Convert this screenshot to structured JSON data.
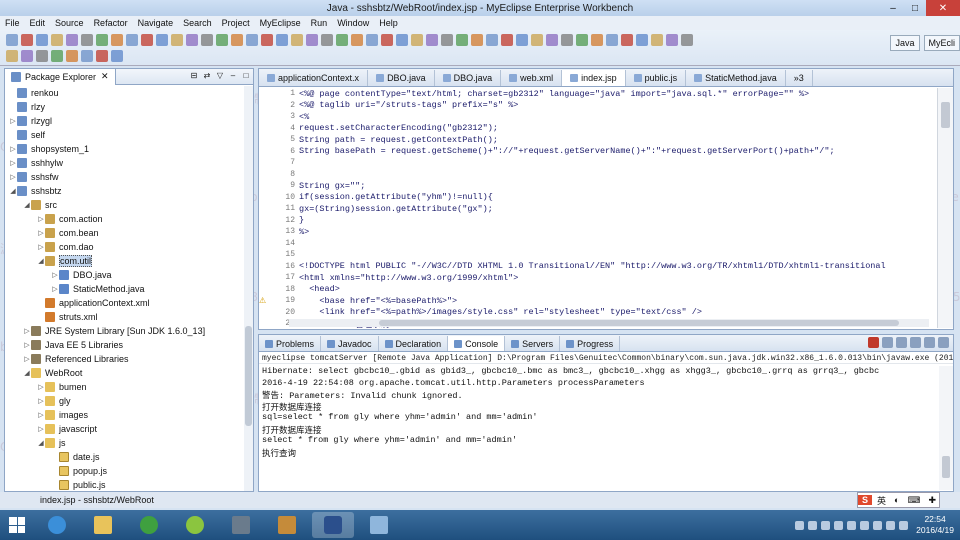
{
  "window": {
    "title": "Java - sshsbtz/WebRoot/index.jsp - MyEclipse Enterprise Workbench",
    "min": "–",
    "max": "□",
    "close": "✕"
  },
  "menu": [
    "File",
    "Edit",
    "Source",
    "Refactor",
    "Navigate",
    "Search",
    "Project",
    "MyEclipse",
    "Run",
    "Window",
    "Help"
  ],
  "perspectives": {
    "java": "Java",
    "myeclipse": "MyEcli"
  },
  "explorer": {
    "title": "Package Explorer",
    "items": [
      {
        "label": "renkou",
        "indent": 0,
        "tw": "",
        "icon": "proj"
      },
      {
        "label": "rlzy",
        "indent": 0,
        "tw": "",
        "icon": "proj"
      },
      {
        "label": "rlzygl",
        "indent": 0,
        "tw": "▷",
        "icon": "proj"
      },
      {
        "label": "self",
        "indent": 0,
        "tw": "",
        "icon": "proj"
      },
      {
        "label": "shopsystem_1",
        "indent": 0,
        "tw": "▷",
        "icon": "proj"
      },
      {
        "label": "sshhylw",
        "indent": 0,
        "tw": "▷",
        "icon": "proj"
      },
      {
        "label": "sshsfw",
        "indent": 0,
        "tw": "▷",
        "icon": "proj"
      },
      {
        "label": "sshsbtz",
        "indent": 0,
        "tw": "◢",
        "icon": "proj"
      },
      {
        "label": "src",
        "indent": 1,
        "tw": "◢",
        "icon": "pkg"
      },
      {
        "label": "com.action",
        "indent": 2,
        "tw": "▷",
        "icon": "pkg"
      },
      {
        "label": "com.bean",
        "indent": 2,
        "tw": "▷",
        "icon": "pkg"
      },
      {
        "label": "com.dao",
        "indent": 2,
        "tw": "▷",
        "icon": "pkg"
      },
      {
        "label": "com.util",
        "indent": 2,
        "tw": "◢",
        "icon": "pkg",
        "sel": true
      },
      {
        "label": "DBO.java",
        "indent": 3,
        "tw": "▷",
        "icon": "java"
      },
      {
        "label": "StaticMethod.java",
        "indent": 3,
        "tw": "▷",
        "icon": "java"
      },
      {
        "label": "applicationContext.xml",
        "indent": 2,
        "tw": "",
        "icon": "xml"
      },
      {
        "label": "struts.xml",
        "indent": 2,
        "tw": "",
        "icon": "xml"
      },
      {
        "label": "JRE System Library [Sun JDK 1.6.0_13]",
        "indent": 1,
        "tw": "▷",
        "icon": "lib"
      },
      {
        "label": "Java EE 5 Libraries",
        "indent": 1,
        "tw": "▷",
        "icon": "lib"
      },
      {
        "label": "Referenced Libraries",
        "indent": 1,
        "tw": "▷",
        "icon": "lib"
      },
      {
        "label": "WebRoot",
        "indent": 1,
        "tw": "◢",
        "icon": "folder"
      },
      {
        "label": "bumen",
        "indent": 2,
        "tw": "▷",
        "icon": "folder"
      },
      {
        "label": "gly",
        "indent": 2,
        "tw": "▷",
        "icon": "folder"
      },
      {
        "label": "images",
        "indent": 2,
        "tw": "▷",
        "icon": "folder"
      },
      {
        "label": "javascript",
        "indent": 2,
        "tw": "▷",
        "icon": "folder"
      },
      {
        "label": "js",
        "indent": 2,
        "tw": "◢",
        "icon": "folder"
      },
      {
        "label": "date.js",
        "indent": 3,
        "tw": "",
        "icon": "file"
      },
      {
        "label": "popup.js",
        "indent": 3,
        "tw": "",
        "icon": "file"
      },
      {
        "label": "public.js",
        "indent": 3,
        "tw": "",
        "icon": "file"
      }
    ]
  },
  "editor": {
    "tabs": [
      {
        "label": "applicationContext.x",
        "active": false
      },
      {
        "label": "DBO.java",
        "active": false
      },
      {
        "label": "DBO.java",
        "active": false
      },
      {
        "label": "web.xml",
        "active": false
      },
      {
        "label": "index.jsp",
        "active": true
      },
      {
        "label": "public.js",
        "active": false
      },
      {
        "label": "StaticMethod.java",
        "active": false
      },
      {
        "label": "»3",
        "active": false
      }
    ],
    "lines": [
      {
        "n": "1",
        "m": "",
        "t": "<%@ page contentType=\"text/html; charset=gb2312\" language=\"java\" import=\"java.sql.*\" errorPage=\"\" %>"
      },
      {
        "n": "2",
        "m": "",
        "t": "<%@ taglib uri=\"/struts-tags\" prefix=\"s\" %>"
      },
      {
        "n": "3",
        "m": "",
        "t": "<%"
      },
      {
        "n": "4",
        "m": "",
        "t": "request.setCharacterEncoding(\"gb2312\");"
      },
      {
        "n": "5",
        "m": "",
        "t": "String path = request.getContextPath();"
      },
      {
        "n": "6",
        "m": "",
        "t": "String basePath = request.getScheme()+\"://\"+request.getServerName()+\":\"+request.getServerPort()+path+\"/\";"
      },
      {
        "n": "7",
        "m": "",
        "t": ""
      },
      {
        "n": "8",
        "m": "",
        "t": ""
      },
      {
        "n": "9",
        "m": "",
        "t": "String gx=\"\";"
      },
      {
        "n": "10",
        "m": "",
        "t": "if(session.getAttribute(\"yhm\")!=null){"
      },
      {
        "n": "11",
        "m": "",
        "t": "gx=(String)session.getAttribute(\"gx\");"
      },
      {
        "n": "12",
        "m": "",
        "t": "}"
      },
      {
        "n": "13",
        "m": "",
        "t": "%>"
      },
      {
        "n": "14",
        "m": "",
        "t": ""
      },
      {
        "n": "15",
        "m": "",
        "t": ""
      },
      {
        "n": "16",
        "m": "",
        "t": "<!DOCTYPE html PUBLIC \"-//W3C//DTD XHTML 1.0 Transitional//EN\" \"http://www.w3.org/TR/xhtml1/DTD/xhtml1-transitional"
      },
      {
        "n": "17",
        "m": "",
        "t": "<html xmlns=\"http://www.w3.org/1999/xhtml\">"
      },
      {
        "n": "18",
        "m": "",
        "t": "  <head>"
      },
      {
        "n": "19",
        "m": "⚠",
        "t": "    <base href=\"<%=basePath%>\">"
      },
      {
        "n": "20",
        "m": "",
        "t": "    <link href=\"<%=path%>/images/style.css\" rel=\"stylesheet\" type=\"text/css\" />"
      },
      {
        "n": "21",
        "m": "",
        "t": "    <title>管理系统 </title>"
      }
    ]
  },
  "console": {
    "tabs": [
      {
        "label": "Problems",
        "active": false
      },
      {
        "label": "Javadoc",
        "active": false
      },
      {
        "label": "Declaration",
        "active": false
      },
      {
        "label": "Console",
        "active": true
      },
      {
        "label": "Servers",
        "active": false
      },
      {
        "label": "Progress",
        "active": false
      }
    ],
    "header": "myeclipse tomcatServer [Remote Java Application] D:\\Program Files\\Genuitec\\Common\\binary\\com.sun.java.jdk.win32.x86_1.6.0.013\\bin\\javaw.exe (2016-4-19 下午10:51:3",
    "lines": [
      "Hibernate: select gbcbc10_.gbid as gbid3_, gbcbc10_.bmc as bmc3_, gbcbc10_.xhgg as xhgg3_, gbcbc10_.grrq as grrq3_, gbcbc",
      "2016-4-19 22:54:08 org.apache.tomcat.util.http.Parameters processParameters",
      "警告: Parameters: Invalid chunk ignored.",
      "打开数据库连接",
      "sql=select * from gly where yhm='admin' and mm='admin'",
      "打开数据库连接",
      "select * from gly where yhm='admin' and mm='admin'",
      "执行查询"
    ]
  },
  "status": {
    "selected": "index.jsp - sshsbtz/WebRoot"
  },
  "ime": {
    "logo": "S",
    "mode": "英"
  },
  "clock": {
    "time": "22:54",
    "date": "2016/4/19"
  },
  "watermark": {
    "cn": "源码定制",
    "en": "bisheonline",
    "qq": "Q251836457"
  }
}
